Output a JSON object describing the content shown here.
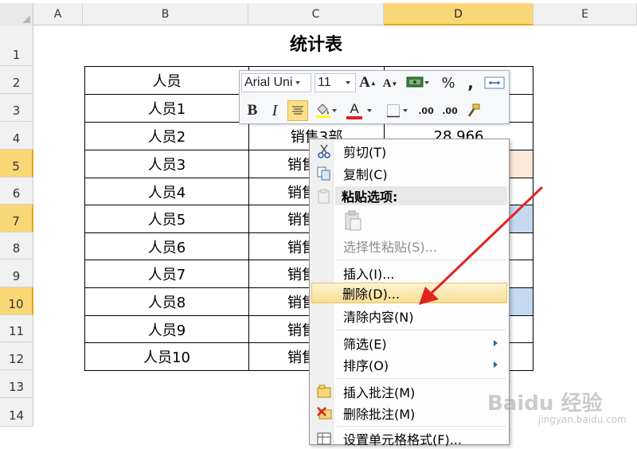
{
  "columns": [
    {
      "label": "A"
    },
    {
      "label": "B"
    },
    {
      "label": "C"
    },
    {
      "label": "D",
      "active": true
    },
    {
      "label": "E"
    }
  ],
  "rows": [
    "1",
    "2",
    "3",
    "4",
    "5",
    "6",
    "7",
    "8",
    "9",
    "10",
    "11",
    "12",
    "13",
    "14"
  ],
  "active_rows": [
    "5",
    "7",
    "10"
  ],
  "sheet_title": "统计表",
  "table": {
    "header_b": "人员",
    "names": [
      "人员1",
      "人员2",
      "人员3",
      "人员4",
      "人员5",
      "人员6",
      "人员7",
      "人员8",
      "人员9",
      "人员10"
    ],
    "dept_row3": "销售3部",
    "dept_partial": "销售",
    "value_row3": "28,966"
  },
  "mini_toolbar": {
    "font_name": "Arial Uni",
    "font_size": "11",
    "grow_font": "A",
    "shrink_font": "A",
    "percent": "%",
    "comma": ",",
    "bold": "B",
    "italic": "I",
    "font_color_letter": "A",
    "dec_increase": ".00",
    "dec_decrease": ".00",
    "font_color": "#e02020"
  },
  "context_menu": {
    "cut": "剪切(T)",
    "copy": "复制(C)",
    "paste_options": "粘贴选项:",
    "paste_special": "选择性粘贴(S)...",
    "insert": "插入(I)...",
    "delete": "删除(D)...",
    "clear_contents": "清除内容(N)",
    "filter": "筛选(E)",
    "sort": "排序(O)",
    "insert_comment": "插入批注(M)",
    "delete_comment": "删除批注(M)",
    "format_cells": "设置单元格格式(F)..."
  },
  "watermark": {
    "brand": "Baidu 经验",
    "url": "jingyan.baidu.com"
  },
  "colors": {
    "active_header": "#f9d776",
    "arrow": "#e02424",
    "selected_fill": "#c5d9f1",
    "highlight_fill": "#fde9d9"
  }
}
